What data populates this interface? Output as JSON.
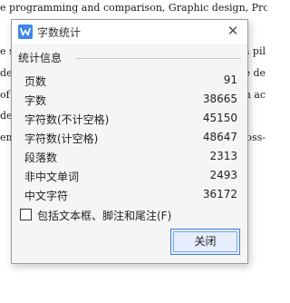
{
  "background_doc": {
    "lines": [
      {
        "left": "e programming and comparison, Graphic design, Profile"
      },
      {
        "left": "e spl",
        "right": "n pil"
      },
      {
        "left": "deve",
        "right": "e de"
      },
      {
        "left": "of t",
        "right": "in ac"
      },
      {
        "left": "deci",
        "right": "ross-"
      },
      {
        "left": "ema"
      }
    ]
  },
  "dialog": {
    "title": "字数统计",
    "close_glyph": "✕",
    "group_title": "统计信息",
    "stats": [
      {
        "label": "页数",
        "value": "91"
      },
      {
        "label": "字数",
        "value": "38665"
      },
      {
        "label": "字符数(不计空格)",
        "value": "45150"
      },
      {
        "label": "字符数(计空格)",
        "value": "48647"
      },
      {
        "label": "段落数",
        "value": "2313"
      },
      {
        "label": "非中文单词",
        "value": "2493"
      },
      {
        "label": "中文字符",
        "value": "36172"
      }
    ],
    "checkbox": {
      "label": "包括文本框、脚注和尾注(F)",
      "checked": false
    },
    "close_button": "关闭"
  },
  "colors": {
    "app_icon": "#3f86e7",
    "button_border": "#3c7fd6"
  }
}
